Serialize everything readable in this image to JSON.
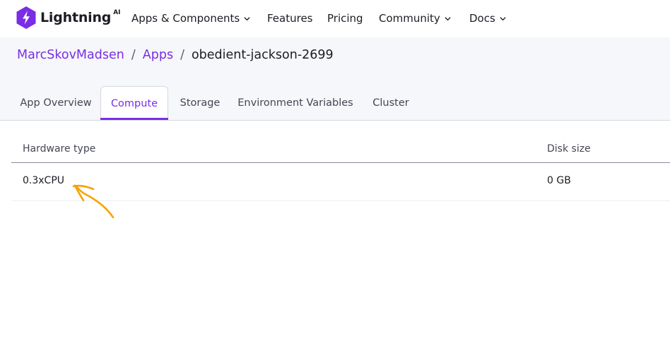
{
  "brand": {
    "name": "Lightning",
    "suffix": "AI",
    "accent": "#792ee5"
  },
  "nav": {
    "items": [
      {
        "label": "Apps & Components",
        "has_dropdown": true
      },
      {
        "label": "Features",
        "has_dropdown": false
      },
      {
        "label": "Pricing",
        "has_dropdown": false
      },
      {
        "label": "Community",
        "has_dropdown": true
      },
      {
        "label": "Docs",
        "has_dropdown": true
      }
    ]
  },
  "breadcrumb": {
    "user": "MarcSkovMadsen",
    "section": "Apps",
    "separator": "/",
    "current": "obedient-jackson-2699"
  },
  "tabs": [
    {
      "label": "App Overview",
      "active": false
    },
    {
      "label": "Compute",
      "active": true
    },
    {
      "label": "Storage",
      "active": false
    },
    {
      "label": "Environment Variables",
      "active": false
    },
    {
      "label": "Cluster",
      "active": false
    }
  ],
  "table": {
    "columns": [
      "Hardware type",
      "Disk size"
    ],
    "rows": [
      [
        "0.3xCPU",
        "0 GB"
      ]
    ]
  },
  "annotation": {
    "color": "#f5a300",
    "icon": "hand-drawn-arrow-icon"
  }
}
